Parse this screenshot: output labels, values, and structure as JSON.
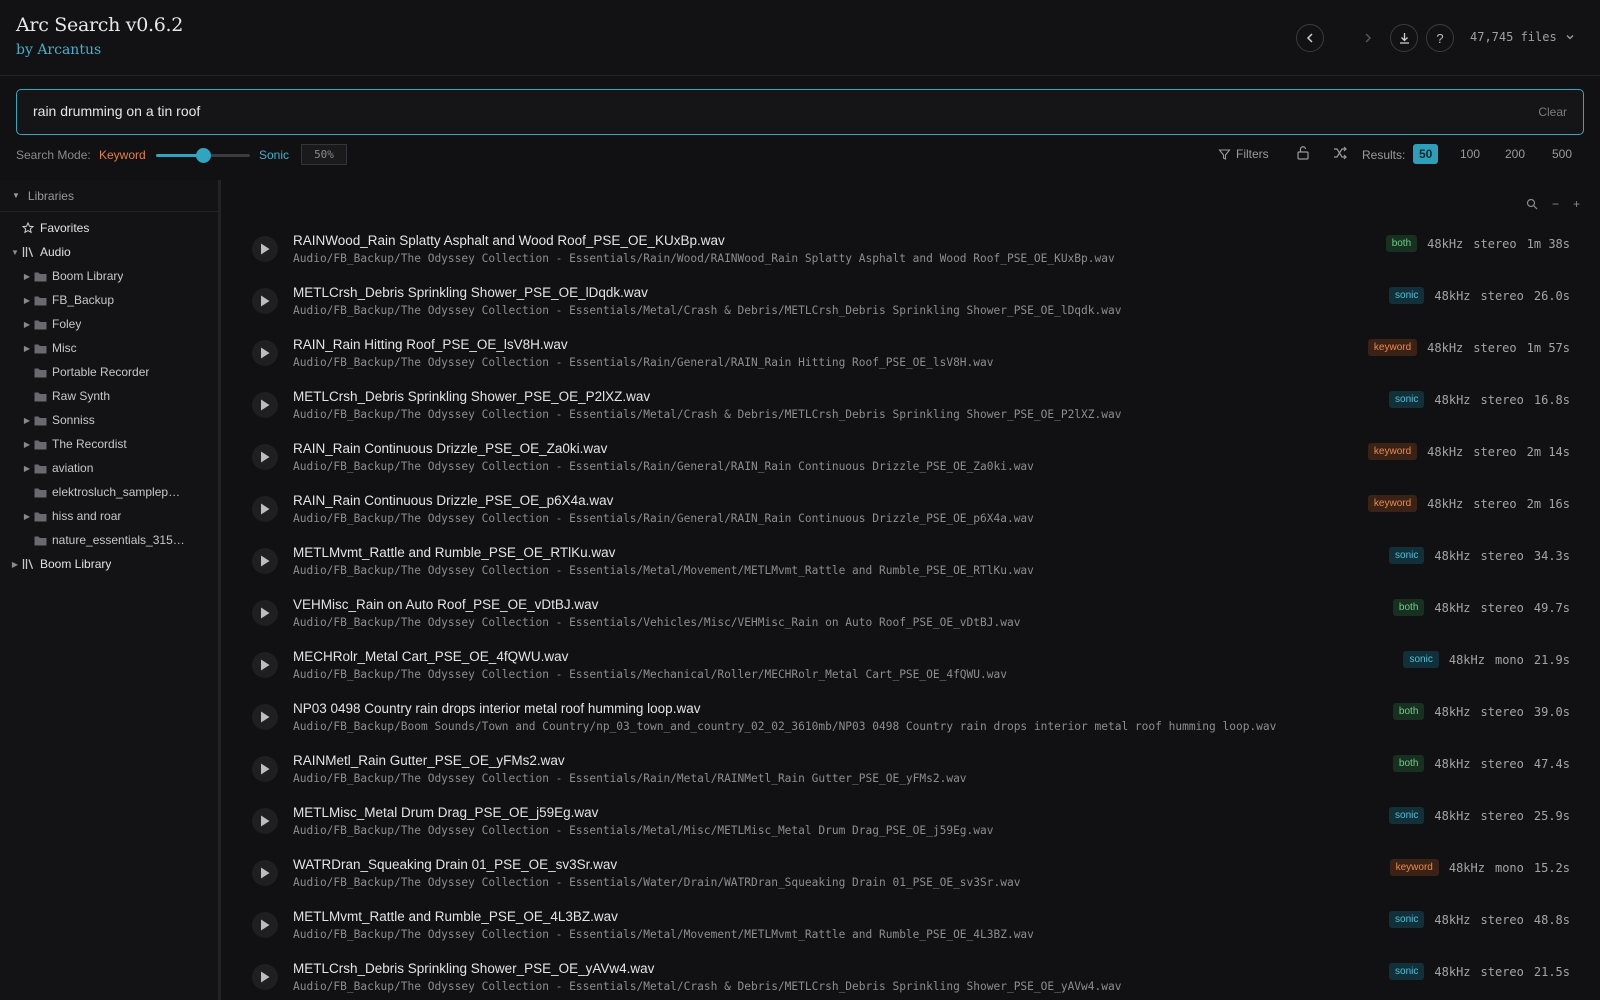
{
  "app": {
    "title": "Arc Search v0.6.2",
    "subtitle": "by Arcantus",
    "file_count": "47,745 files"
  },
  "search": {
    "value": "rain drumming on a tin roof",
    "clear_label": "Clear"
  },
  "mode": {
    "label": "Search Mode:",
    "keyword": "Keyword",
    "sonic": "Sonic",
    "percent": "50%",
    "level": 0.5
  },
  "toolbar": {
    "filters": "Filters",
    "results_label": "Results:",
    "results_options": [
      "50",
      "100",
      "200",
      "500"
    ],
    "results_selected": "50"
  },
  "sidebar": {
    "header": "Libraries",
    "items": [
      {
        "label": "Favorites",
        "depth": 0,
        "icon": "star-icon",
        "caret": ""
      },
      {
        "label": "Audio",
        "depth": 0,
        "icon": "library-icon",
        "caret": "open"
      },
      {
        "label": "Boom Library",
        "depth": 1,
        "icon": "folder-icon",
        "caret": "closed"
      },
      {
        "label": "FB_Backup",
        "depth": 1,
        "icon": "folder-icon",
        "caret": "closed"
      },
      {
        "label": "Foley",
        "depth": 1,
        "icon": "folder-icon",
        "caret": "closed"
      },
      {
        "label": "Misc",
        "depth": 1,
        "icon": "folder-icon",
        "caret": "closed"
      },
      {
        "label": "Portable Recorder",
        "depth": 1,
        "icon": "folder-icon",
        "caret": ""
      },
      {
        "label": "Raw Synth",
        "depth": 1,
        "icon": "folder-icon",
        "caret": ""
      },
      {
        "label": "Sonniss",
        "depth": 1,
        "icon": "folder-icon",
        "caret": "closed"
      },
      {
        "label": "The Recordist",
        "depth": 1,
        "icon": "folder-icon",
        "caret": "closed"
      },
      {
        "label": "aviation",
        "depth": 1,
        "icon": "folder-icon",
        "caret": "closed"
      },
      {
        "label": "elektrosluch_samplep…",
        "depth": 1,
        "icon": "folder-icon",
        "caret": ""
      },
      {
        "label": "hiss and roar",
        "depth": 1,
        "icon": "folder-icon",
        "caret": "closed"
      },
      {
        "label": "nature_essentials_315…",
        "depth": 1,
        "icon": "folder-icon",
        "caret": ""
      },
      {
        "label": "Boom Library",
        "depth": 0,
        "icon": "library-icon",
        "caret": "closed"
      }
    ]
  },
  "results": [
    {
      "name": "RAINWood_Rain Splatty Asphalt and Wood Roof_PSE_OE_KUxBp.wav",
      "path": "Audio/FB_Backup/The Odyssey Collection - Essentials/Rain/Wood/RAINWood_Rain Splatty Asphalt and Wood Roof_PSE_OE_KUxBp.wav",
      "match": "both",
      "rate": "48kHz",
      "channels": "stereo",
      "duration": "1m 38s"
    },
    {
      "name": "METLCrsh_Debris Sprinkling Shower_PSE_OE_lDqdk.wav",
      "path": "Audio/FB_Backup/The Odyssey Collection - Essentials/Metal/Crash & Debris/METLCrsh_Debris Sprinkling Shower_PSE_OE_lDqdk.wav",
      "match": "sonic",
      "rate": "48kHz",
      "channels": "stereo",
      "duration": "26.0s"
    },
    {
      "name": "RAIN_Rain Hitting Roof_PSE_OE_lsV8H.wav",
      "path": "Audio/FB_Backup/The Odyssey Collection - Essentials/Rain/General/RAIN_Rain Hitting Roof_PSE_OE_lsV8H.wav",
      "match": "keyword",
      "rate": "48kHz",
      "channels": "stereo",
      "duration": "1m 57s"
    },
    {
      "name": "METLCrsh_Debris Sprinkling Shower_PSE_OE_P2lXZ.wav",
      "path": "Audio/FB_Backup/The Odyssey Collection - Essentials/Metal/Crash & Debris/METLCrsh_Debris Sprinkling Shower_PSE_OE_P2lXZ.wav",
      "match": "sonic",
      "rate": "48kHz",
      "channels": "stereo",
      "duration": "16.8s"
    },
    {
      "name": "RAIN_Rain Continuous Drizzle_PSE_OE_Za0ki.wav",
      "path": "Audio/FB_Backup/The Odyssey Collection - Essentials/Rain/General/RAIN_Rain Continuous Drizzle_PSE_OE_Za0ki.wav",
      "match": "keyword",
      "rate": "48kHz",
      "channels": "stereo",
      "duration": "2m 14s"
    },
    {
      "name": "RAIN_Rain Continuous Drizzle_PSE_OE_p6X4a.wav",
      "path": "Audio/FB_Backup/The Odyssey Collection - Essentials/Rain/General/RAIN_Rain Continuous Drizzle_PSE_OE_p6X4a.wav",
      "match": "keyword",
      "rate": "48kHz",
      "channels": "stereo",
      "duration": "2m 16s"
    },
    {
      "name": "METLMvmt_Rattle and Rumble_PSE_OE_RTlKu.wav",
      "path": "Audio/FB_Backup/The Odyssey Collection - Essentials/Metal/Movement/METLMvmt_Rattle and Rumble_PSE_OE_RTlKu.wav",
      "match": "sonic",
      "rate": "48kHz",
      "channels": "stereo",
      "duration": "34.3s"
    },
    {
      "name": "VEHMisc_Rain on Auto Roof_PSE_OE_vDtBJ.wav",
      "path": "Audio/FB_Backup/The Odyssey Collection - Essentials/Vehicles/Misc/VEHMisc_Rain on Auto Roof_PSE_OE_vDtBJ.wav",
      "match": "both",
      "rate": "48kHz",
      "channels": "stereo",
      "duration": "49.7s"
    },
    {
      "name": "MECHRolr_Metal Cart_PSE_OE_4fQWU.wav",
      "path": "Audio/FB_Backup/The Odyssey Collection - Essentials/Mechanical/Roller/MECHRolr_Metal Cart_PSE_OE_4fQWU.wav",
      "match": "sonic",
      "rate": "48kHz",
      "channels": "mono",
      "duration": "21.9s"
    },
    {
      "name": "NP03 0498 Country rain drops interior metal roof humming loop.wav",
      "path": "Audio/FB_Backup/Boom Sounds/Town and Country/np_03_town_and_country_02_02_3610mb/NP03 0498 Country rain drops interior metal roof humming loop.wav",
      "match": "both",
      "rate": "48kHz",
      "channels": "stereo",
      "duration": "39.0s"
    },
    {
      "name": "RAINMetl_Rain Gutter_PSE_OE_yFMs2.wav",
      "path": "Audio/FB_Backup/The Odyssey Collection - Essentials/Rain/Metal/RAINMetl_Rain Gutter_PSE_OE_yFMs2.wav",
      "match": "both",
      "rate": "48kHz",
      "channels": "stereo",
      "duration": "47.4s"
    },
    {
      "name": "METLMisc_Metal Drum Drag_PSE_OE_j59Eg.wav",
      "path": "Audio/FB_Backup/The Odyssey Collection - Essentials/Metal/Misc/METLMisc_Metal Drum Drag_PSE_OE_j59Eg.wav",
      "match": "sonic",
      "rate": "48kHz",
      "channels": "stereo",
      "duration": "25.9s"
    },
    {
      "name": "WATRDran_Squeaking Drain 01_PSE_OE_sv3Sr.wav",
      "path": "Audio/FB_Backup/The Odyssey Collection - Essentials/Water/Drain/WATRDran_Squeaking Drain 01_PSE_OE_sv3Sr.wav",
      "match": "keyword",
      "rate": "48kHz",
      "channels": "mono",
      "duration": "15.2s"
    },
    {
      "name": "METLMvmt_Rattle and Rumble_PSE_OE_4L3BZ.wav",
      "path": "Audio/FB_Backup/The Odyssey Collection - Essentials/Metal/Movement/METLMvmt_Rattle and Rumble_PSE_OE_4L3BZ.wav",
      "match": "sonic",
      "rate": "48kHz",
      "channels": "stereo",
      "duration": "48.8s"
    },
    {
      "name": "METLCrsh_Debris Sprinkling Shower_PSE_OE_yAVw4.wav",
      "path": "Audio/FB_Backup/The Odyssey Collection - Essentials/Metal/Crash & Debris/METLCrsh_Debris Sprinkling Shower_PSE_OE_yAVw4.wav",
      "match": "sonic",
      "rate": "48kHz",
      "channels": "stereo",
      "duration": "21.5s"
    }
  ],
  "colors": {
    "accent": "#2fa5bf",
    "keyword": "#e0803d",
    "both": "#6fd08a"
  }
}
